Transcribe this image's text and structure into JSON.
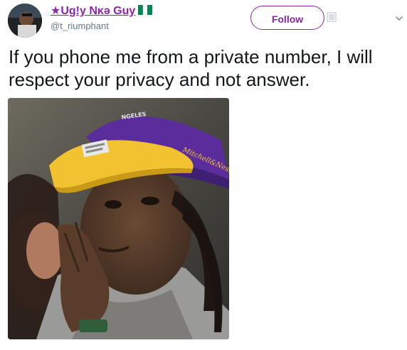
{
  "user": {
    "display_name": "★Ug!y Nκә Guy",
    "handle": "@t_riumphant",
    "flag_colors": [
      "#008751",
      "#ffffff",
      "#008751"
    ]
  },
  "follow_button": {
    "label": "Follow"
  },
  "tweet": {
    "text": "If you phone me from a private number, I will respect your privacy and not answer."
  },
  "photo": {
    "cap_text": "Mitchell&Ness",
    "cap_top_text": "NGELES"
  },
  "colors": {
    "accent": "#8e24aa",
    "cap_purple": "#5b2d9c",
    "cap_gold": "#f2c230"
  }
}
